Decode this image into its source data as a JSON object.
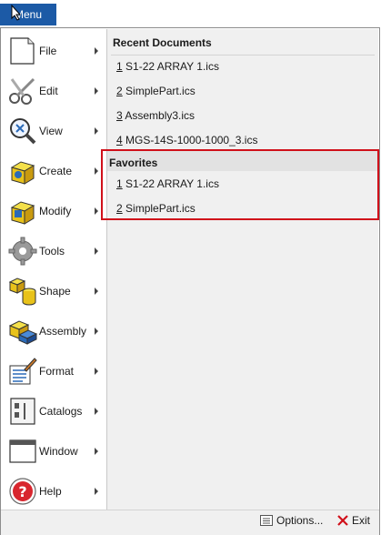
{
  "menu_button": {
    "label": "Menu"
  },
  "left_menu": {
    "items": [
      {
        "label": "File",
        "icon": "file-icon"
      },
      {
        "label": "Edit",
        "icon": "scissors-icon"
      },
      {
        "label": "View",
        "icon": "magnifier-icon"
      },
      {
        "label": "Create",
        "icon": "create-cube-icon"
      },
      {
        "label": "Modify",
        "icon": "modify-cube-icon"
      },
      {
        "label": "Tools",
        "icon": "gear-icon"
      },
      {
        "label": "Shape",
        "icon": "shape-icon"
      },
      {
        "label": "Assembly",
        "icon": "assembly-icon"
      },
      {
        "label": "Format",
        "icon": "format-brush-icon"
      },
      {
        "label": "Catalogs",
        "icon": "catalog-icon"
      },
      {
        "label": "Window",
        "icon": "window-icon"
      },
      {
        "label": "Help",
        "icon": "help-icon"
      }
    ]
  },
  "recent": {
    "title": "Recent Documents",
    "items": [
      {
        "num": "1",
        "name": "S1-22 ARRAY 1.ics"
      },
      {
        "num": "2",
        "name": "SimplePart.ics"
      },
      {
        "num": "3",
        "name": "Assembly3.ics"
      },
      {
        "num": "4",
        "name": "MGS-14S-1000-1000_3.ics"
      }
    ]
  },
  "favorites": {
    "title": "Favorites",
    "items": [
      {
        "num": "1",
        "name": "S1-22 ARRAY 1.ics"
      },
      {
        "num": "2",
        "name": "SimplePart.ics"
      }
    ]
  },
  "footer": {
    "options_label": "Options...",
    "exit_label": "Exit"
  },
  "colors": {
    "accent": "#1c5aa6",
    "highlight_border": "#d0101a",
    "exit_red": "#d0101a"
  }
}
